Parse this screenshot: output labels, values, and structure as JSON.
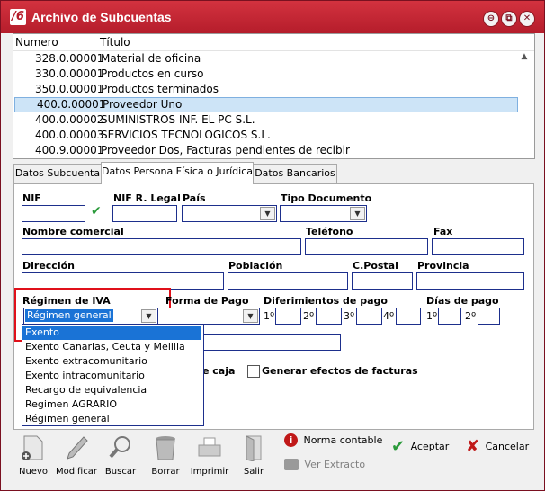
{
  "window": {
    "title": "Archivo de Subcuentas",
    "app_icon": "/6",
    "controls": [
      "⊖",
      "⧉",
      "✕"
    ]
  },
  "list": {
    "headers": {
      "numero": "Numero",
      "titulo": "Título"
    },
    "rows": [
      {
        "num": "328.0.00001",
        "tit": "Material de oficina"
      },
      {
        "num": "330.0.00001",
        "tit": "Productos en curso"
      },
      {
        "num": "350.0.00001",
        "tit": "Productos terminados"
      },
      {
        "num": "400.0.00001",
        "tit": "Proveedor Uno"
      },
      {
        "num": "400.0.00002",
        "tit": "SUMINISTROS INF. EL PC S.L."
      },
      {
        "num": "400.0.00003",
        "tit": "SERVICIOS TECNOLOGICOS S.L."
      },
      {
        "num": "400.9.00001",
        "tit": "Proveedor Dos, Facturas pendientes de recibir"
      }
    ]
  },
  "tabs": [
    "Datos Subcuenta",
    "Datos Persona Física o Jurídica",
    "Datos Bancarios"
  ],
  "form": {
    "nif": "NIF",
    "nif_legal": "NIF R. Legal",
    "pais": "País",
    "tipo_documento": "Tipo Documento",
    "nombre_comercial": "Nombre comercial",
    "telefono": "Teléfono",
    "fax": "Fax",
    "direccion": "Dirección",
    "poblacion": "Población",
    "cpostal": "C.Postal",
    "provincia": "Provincia",
    "regimen_iva": "Régimen de IVA",
    "regimen_value": "Régimen general",
    "forma_pago": "Forma de Pago",
    "diferimientos": "Diferimientos de pago",
    "dias_pago": "Días de pago",
    "dif_labels": [
      "1º",
      "2º",
      "3º",
      "4º"
    ],
    "dias_labels": [
      "1º",
      "2º"
    ],
    "caja_fragment": "e caja",
    "generar_efectos": "Generar efectos de facturas"
  },
  "regimen_options": [
    "Exento",
    "Exento Canarias, Ceuta y Melilla",
    "Exento extracomunitario",
    "Exento intracomunitario",
    "Recargo de equivalencia",
    "Regimen AGRARIO",
    "Régimen general"
  ],
  "toolbar": {
    "nuevo": "Nuevo",
    "modificar": "Modificar",
    "buscar": "Buscar",
    "borrar": "Borrar",
    "imprimir": "Imprimir",
    "salir": "Salir",
    "norma_contable": "Norma contable",
    "ver_extracto": "Ver Extracto",
    "aceptar": "Aceptar",
    "cancelar": "Cancelar"
  },
  "colors": {
    "title_bar": "#c0262f",
    "selection": "#1a73d6",
    "highlight_box": "#e0101a",
    "accept": "#2a9a3a",
    "cancel": "#c01818"
  }
}
